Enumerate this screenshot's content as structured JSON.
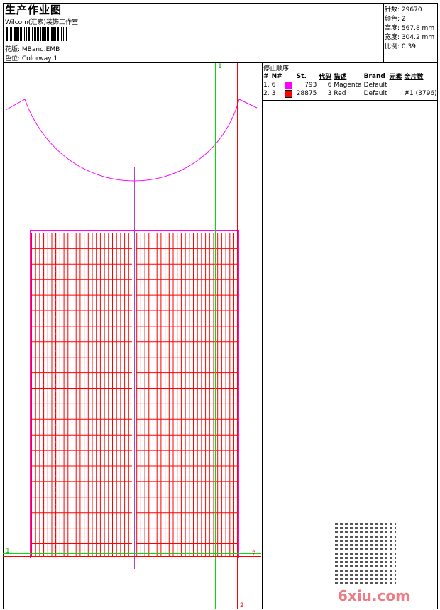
{
  "header": {
    "title": "生产作业图",
    "company": "Wilcom(汇索)装饰工作室",
    "design_label": "花版:",
    "design_value": "MBang.EMB",
    "colorway_label": "色位:",
    "colorway_value": "Colorway 1"
  },
  "info": [
    {
      "label": "针数:",
      "value": "29670"
    },
    {
      "label": "颜色:",
      "value": "2"
    },
    {
      "label": "高度:",
      "value": "567.8 mm"
    },
    {
      "label": "宽度:",
      "value": "304.2 mm"
    },
    {
      "label": "比例:",
      "value": "0.39"
    }
  ],
  "stop_sequence": {
    "title": "停止顺序:",
    "columns": [
      "#",
      "N#",
      "",
      "St.",
      "代码",
      "描述",
      "Brand",
      "元素",
      "金片数"
    ],
    "rows": [
      {
        "idx": "1.",
        "n": "6",
        "color": "#ff00ff",
        "st": "793",
        "code": "6",
        "desc": "Magenta",
        "brand": "Default",
        "element": "",
        "sequins": ""
      },
      {
        "idx": "2.",
        "n": "3",
        "color": "#ff0000",
        "st": "28875",
        "code": "3",
        "desc": "Red",
        "brand": "Default",
        "element": "",
        "sequins": "#1 (3796)"
      }
    ]
  },
  "markers": {
    "top_green": "1",
    "left_green": "1",
    "right_red": "2",
    "bottom_red": "2"
  },
  "watermark": "6xiu.com"
}
